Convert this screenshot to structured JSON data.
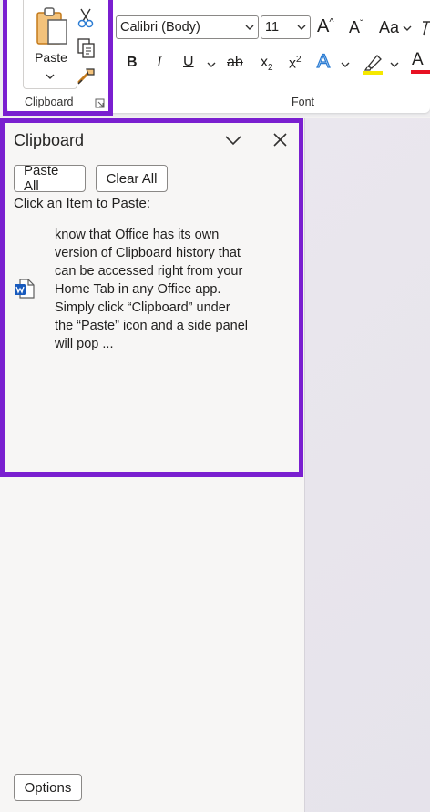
{
  "ribbon": {
    "clipboard_group": {
      "paste_label": "Paste",
      "group_label": "Clipboard"
    },
    "font_group": {
      "font_name": "Calibri (Body)",
      "font_size": "11",
      "grow_font": "A",
      "shrink_font": "A",
      "change_case": "Aa",
      "bold": "B",
      "italic": "I",
      "underline": "U",
      "strikethrough": "ab",
      "subscript": "x",
      "subscript_mark": "2",
      "superscript": "x",
      "superscript_mark": "2",
      "text_effects": "A",
      "font_color": "A",
      "group_label": "Font"
    },
    "colors": {
      "highlight": "#f5e800",
      "font_color": "#e81123",
      "text_effects": "#2b7cd3",
      "accent_outline": "#7a1fd0"
    }
  },
  "clipboard_pane": {
    "title": "Clipboard",
    "paste_all": "Paste All",
    "clear_all": "Clear All",
    "hint": "Click an Item to Paste:",
    "items": [
      {
        "icon": "word-doc-icon",
        "text": "know that Office has its own\nversion of Clipboard history that\ncan be accessed right from your\nHome Tab in any Office app.\nSimply click “Clipboard” under\nthe “Paste” icon and a side panel\nwill pop ..."
      }
    ],
    "options_label": "Options"
  }
}
